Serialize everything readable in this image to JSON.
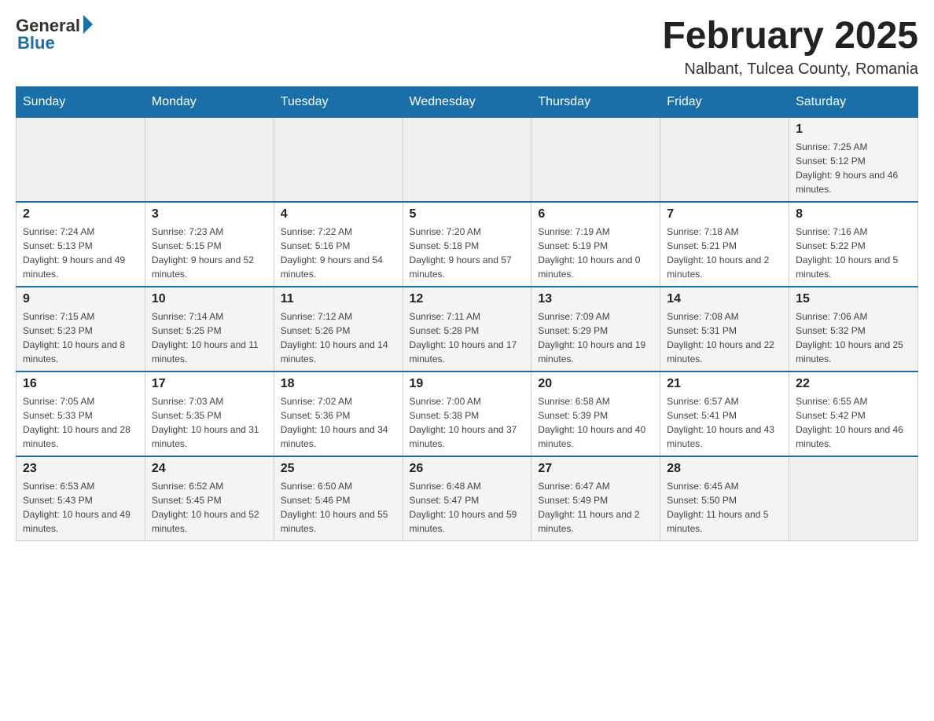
{
  "header": {
    "logo": {
      "general": "General",
      "blue": "Blue"
    },
    "title": "February 2025",
    "location": "Nalbant, Tulcea County, Romania"
  },
  "weekdays": [
    "Sunday",
    "Monday",
    "Tuesday",
    "Wednesday",
    "Thursday",
    "Friday",
    "Saturday"
  ],
  "weeks": [
    [
      {
        "day": "",
        "info": ""
      },
      {
        "day": "",
        "info": ""
      },
      {
        "day": "",
        "info": ""
      },
      {
        "day": "",
        "info": ""
      },
      {
        "day": "",
        "info": ""
      },
      {
        "day": "",
        "info": ""
      },
      {
        "day": "1",
        "info": "Sunrise: 7:25 AM\nSunset: 5:12 PM\nDaylight: 9 hours and 46 minutes."
      }
    ],
    [
      {
        "day": "2",
        "info": "Sunrise: 7:24 AM\nSunset: 5:13 PM\nDaylight: 9 hours and 49 minutes."
      },
      {
        "day": "3",
        "info": "Sunrise: 7:23 AM\nSunset: 5:15 PM\nDaylight: 9 hours and 52 minutes."
      },
      {
        "day": "4",
        "info": "Sunrise: 7:22 AM\nSunset: 5:16 PM\nDaylight: 9 hours and 54 minutes."
      },
      {
        "day": "5",
        "info": "Sunrise: 7:20 AM\nSunset: 5:18 PM\nDaylight: 9 hours and 57 minutes."
      },
      {
        "day": "6",
        "info": "Sunrise: 7:19 AM\nSunset: 5:19 PM\nDaylight: 10 hours and 0 minutes."
      },
      {
        "day": "7",
        "info": "Sunrise: 7:18 AM\nSunset: 5:21 PM\nDaylight: 10 hours and 2 minutes."
      },
      {
        "day": "8",
        "info": "Sunrise: 7:16 AM\nSunset: 5:22 PM\nDaylight: 10 hours and 5 minutes."
      }
    ],
    [
      {
        "day": "9",
        "info": "Sunrise: 7:15 AM\nSunset: 5:23 PM\nDaylight: 10 hours and 8 minutes."
      },
      {
        "day": "10",
        "info": "Sunrise: 7:14 AM\nSunset: 5:25 PM\nDaylight: 10 hours and 11 minutes."
      },
      {
        "day": "11",
        "info": "Sunrise: 7:12 AM\nSunset: 5:26 PM\nDaylight: 10 hours and 14 minutes."
      },
      {
        "day": "12",
        "info": "Sunrise: 7:11 AM\nSunset: 5:28 PM\nDaylight: 10 hours and 17 minutes."
      },
      {
        "day": "13",
        "info": "Sunrise: 7:09 AM\nSunset: 5:29 PM\nDaylight: 10 hours and 19 minutes."
      },
      {
        "day": "14",
        "info": "Sunrise: 7:08 AM\nSunset: 5:31 PM\nDaylight: 10 hours and 22 minutes."
      },
      {
        "day": "15",
        "info": "Sunrise: 7:06 AM\nSunset: 5:32 PM\nDaylight: 10 hours and 25 minutes."
      }
    ],
    [
      {
        "day": "16",
        "info": "Sunrise: 7:05 AM\nSunset: 5:33 PM\nDaylight: 10 hours and 28 minutes."
      },
      {
        "day": "17",
        "info": "Sunrise: 7:03 AM\nSunset: 5:35 PM\nDaylight: 10 hours and 31 minutes."
      },
      {
        "day": "18",
        "info": "Sunrise: 7:02 AM\nSunset: 5:36 PM\nDaylight: 10 hours and 34 minutes."
      },
      {
        "day": "19",
        "info": "Sunrise: 7:00 AM\nSunset: 5:38 PM\nDaylight: 10 hours and 37 minutes."
      },
      {
        "day": "20",
        "info": "Sunrise: 6:58 AM\nSunset: 5:39 PM\nDaylight: 10 hours and 40 minutes."
      },
      {
        "day": "21",
        "info": "Sunrise: 6:57 AM\nSunset: 5:41 PM\nDaylight: 10 hours and 43 minutes."
      },
      {
        "day": "22",
        "info": "Sunrise: 6:55 AM\nSunset: 5:42 PM\nDaylight: 10 hours and 46 minutes."
      }
    ],
    [
      {
        "day": "23",
        "info": "Sunrise: 6:53 AM\nSunset: 5:43 PM\nDaylight: 10 hours and 49 minutes."
      },
      {
        "day": "24",
        "info": "Sunrise: 6:52 AM\nSunset: 5:45 PM\nDaylight: 10 hours and 52 minutes."
      },
      {
        "day": "25",
        "info": "Sunrise: 6:50 AM\nSunset: 5:46 PM\nDaylight: 10 hours and 55 minutes."
      },
      {
        "day": "26",
        "info": "Sunrise: 6:48 AM\nSunset: 5:47 PM\nDaylight: 10 hours and 59 minutes."
      },
      {
        "day": "27",
        "info": "Sunrise: 6:47 AM\nSunset: 5:49 PM\nDaylight: 11 hours and 2 minutes."
      },
      {
        "day": "28",
        "info": "Sunrise: 6:45 AM\nSunset: 5:50 PM\nDaylight: 11 hours and 5 minutes."
      },
      {
        "day": "",
        "info": ""
      }
    ]
  ]
}
